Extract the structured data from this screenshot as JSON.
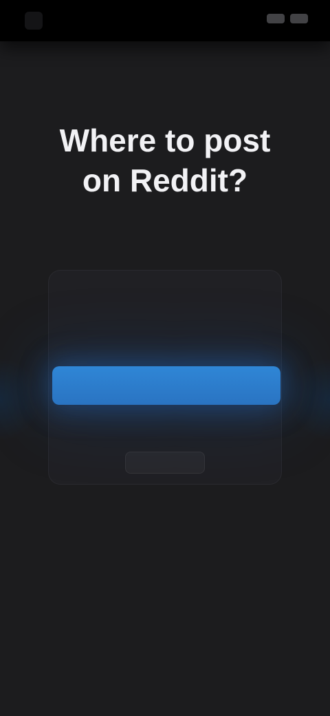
{
  "status_bar": {
    "time": "",
    "app_icon": "app-icon"
  },
  "welcome": {
    "headline_line1": "Where to post",
    "headline_line2": "on Reddit?",
    "subtitle": ""
  },
  "card": {
    "text": "",
    "primary_button_label": "",
    "secondary_button_label": ""
  },
  "colors": {
    "background": "#1c1c1e",
    "accent": "#2f86d6"
  }
}
